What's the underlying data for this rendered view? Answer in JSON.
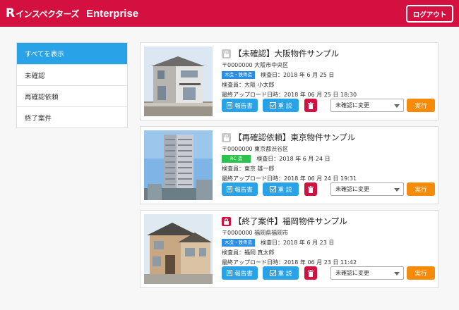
{
  "header": {
    "logo_mark": "R",
    "logo_name": "インスペクターズ",
    "edition": "Enterprise",
    "logout_label": "ログアウト"
  },
  "sidebar": {
    "items": [
      {
        "label": "すべてを表示",
        "active": true
      },
      {
        "label": "未確認",
        "active": false
      },
      {
        "label": "再確認依頼",
        "active": false
      },
      {
        "label": "終了案件",
        "active": false
      }
    ]
  },
  "cards": [
    {
      "title": "【未確認】大阪物件サンプル",
      "locked": false,
      "address": "〒0000000 大阪市中央区",
      "structure": "木造・鉄骨造",
      "inspection_date": "検査日：2018 年 6 月 25 日",
      "inspector": "検査員：大阪 小太郎",
      "last_upload": "最終アップロード日時：2018 年 06 月 25 日 18:30"
    },
    {
      "title": "【再確認依頼】東京物件サンプル",
      "locked": false,
      "address": "〒0000000 東京都渋谷区",
      "structure": "RC 造",
      "inspection_date": "検査日：2018 年 6 月 24 日",
      "inspector": "検査員：東京 雄一郎",
      "last_upload": "最終アップロード日時：2018 年 06 月 24 日 19:31"
    },
    {
      "title": "【終了案件】福岡物件サンプル",
      "locked": true,
      "address": "〒0000000 福岡県福岡市",
      "structure": "木造・鉄骨造",
      "inspection_date": "検査日：2018 年 6 月 23 日",
      "inspector": "検査員：福岡 真太郎",
      "last_upload": "最終アップロード日時：2018 年 06 月 23 日 11:42"
    }
  ],
  "actions": {
    "report_label": "報告書",
    "memo_label": "重 説",
    "status_select_value": "未確認に変更",
    "execute_label": "実行"
  },
  "colors": {
    "brand": "#d31040",
    "primary": "#2aa2e8",
    "accent": "#f58b09",
    "tag_wood": "#2a8ee6",
    "tag_rc": "#2bc34d"
  },
  "icons": {
    "lock_open": "lock-open-icon",
    "lock_closed": "lock-icon",
    "report": "document-icon",
    "memo": "checkbox-icon",
    "delete": "trash-icon"
  }
}
